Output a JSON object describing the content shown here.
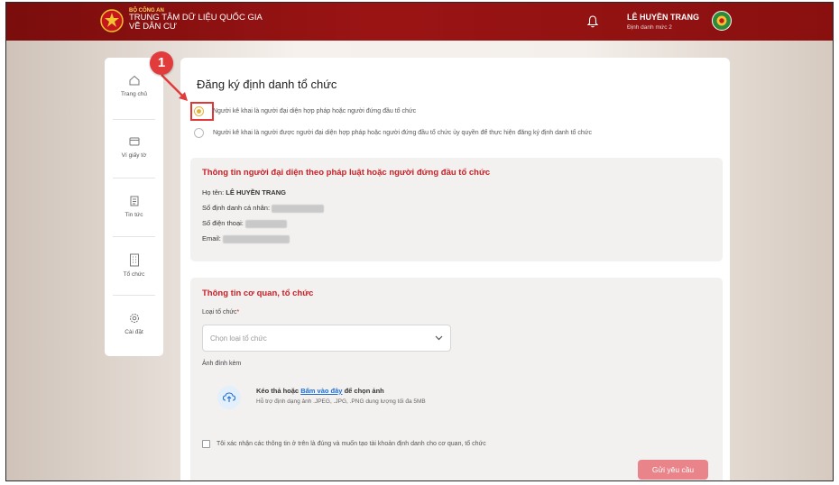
{
  "header": {
    "org": "BỘ CÔNG AN",
    "title_line1": "TRUNG TÂM DỮ LIỆU QUỐC GIA",
    "title_line2": "VỀ DÂN CƯ",
    "user_name": "LÊ HUYỀN TRANG",
    "user_level": "Định danh mức 2",
    "icons": [
      "emblem-icon",
      "bell-icon",
      "avatar-icon"
    ]
  },
  "sidebar": {
    "items": [
      {
        "label": "Trang chủ",
        "icon": "home-icon"
      },
      {
        "label": "Ví giấy tờ",
        "icon": "wallet-icon"
      },
      {
        "label": "Tin tức",
        "icon": "news-icon"
      },
      {
        "label": "Tổ chức",
        "icon": "building-icon"
      },
      {
        "label": "Cài đặt",
        "icon": "gear-icon"
      }
    ]
  },
  "form": {
    "title": "Đăng ký định danh tổ chức",
    "option1": "Người kê khai là người đại diện hợp pháp hoặc người đứng đầu tổ chức",
    "option2": "Người kê khai là người được người đại diện hợp pháp hoặc người đứng đầu tổ chức ủy quyền để thực hiện đăng ký định danh tổ chức",
    "selected_option": 1,
    "rep_section": {
      "title": "Thông tin người đại diện theo pháp luật hoặc người đứng đầu tổ chức",
      "name_label": "Họ tên:",
      "name_value": "LÊ HUYỀN TRANG",
      "id_label": "Số định danh cá nhân:",
      "phone_label": "Số điện thoại:",
      "email_label": "Email:"
    },
    "org_section": {
      "title": "Thông tin cơ quan, tổ chức",
      "type_label": "Loại tổ chức",
      "required_mark": "*",
      "type_placeholder": "Chọn loại tổ chức",
      "attachment_label": "Ảnh đính kèm",
      "upload_prefix": "Kéo thả hoặc",
      "upload_link": "Bấm vào đây",
      "upload_suffix": "để chọn ảnh",
      "upload_hint": "Hỗ trợ định dạng ảnh .JPEG, .JPG, .PNG dung lượng tối đa 5MB",
      "confirm_text": "Tôi xác nhận các thông tin ở trên là đúng và muốn tạo tài khoản định danh cho cơ quan, tổ chức",
      "submit_label": "Gửi yêu cầu"
    }
  },
  "annotation": {
    "step": "1"
  },
  "colors": {
    "header_red": "#9b1414",
    "accent_red": "#c81f26",
    "radio_selected": "#e3b23c",
    "submit_disabled": "#e9858a",
    "link_blue": "#1f6fd1"
  }
}
